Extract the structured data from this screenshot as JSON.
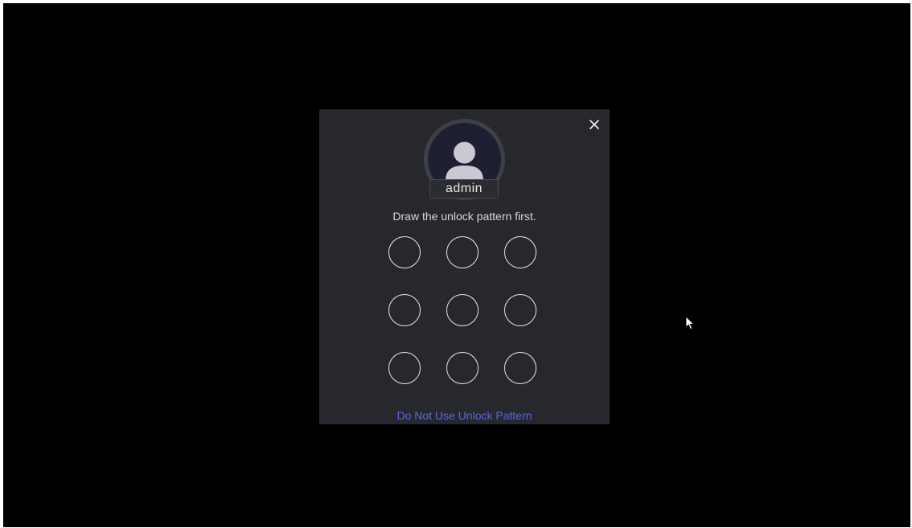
{
  "dialog": {
    "username": "admin",
    "prompt": "Draw the unlock pattern first.",
    "skip_link": "Do Not Use Unlock Pattern",
    "close_icon": "close-icon",
    "avatar_icon": "user-avatar-icon",
    "pattern_dots": [
      1,
      2,
      3,
      4,
      5,
      6,
      7,
      8,
      9
    ]
  },
  "colors": {
    "background": "#000000",
    "dialog_bg": "#27282d",
    "link": "#5a67e0",
    "text": "#d8d8d8"
  }
}
